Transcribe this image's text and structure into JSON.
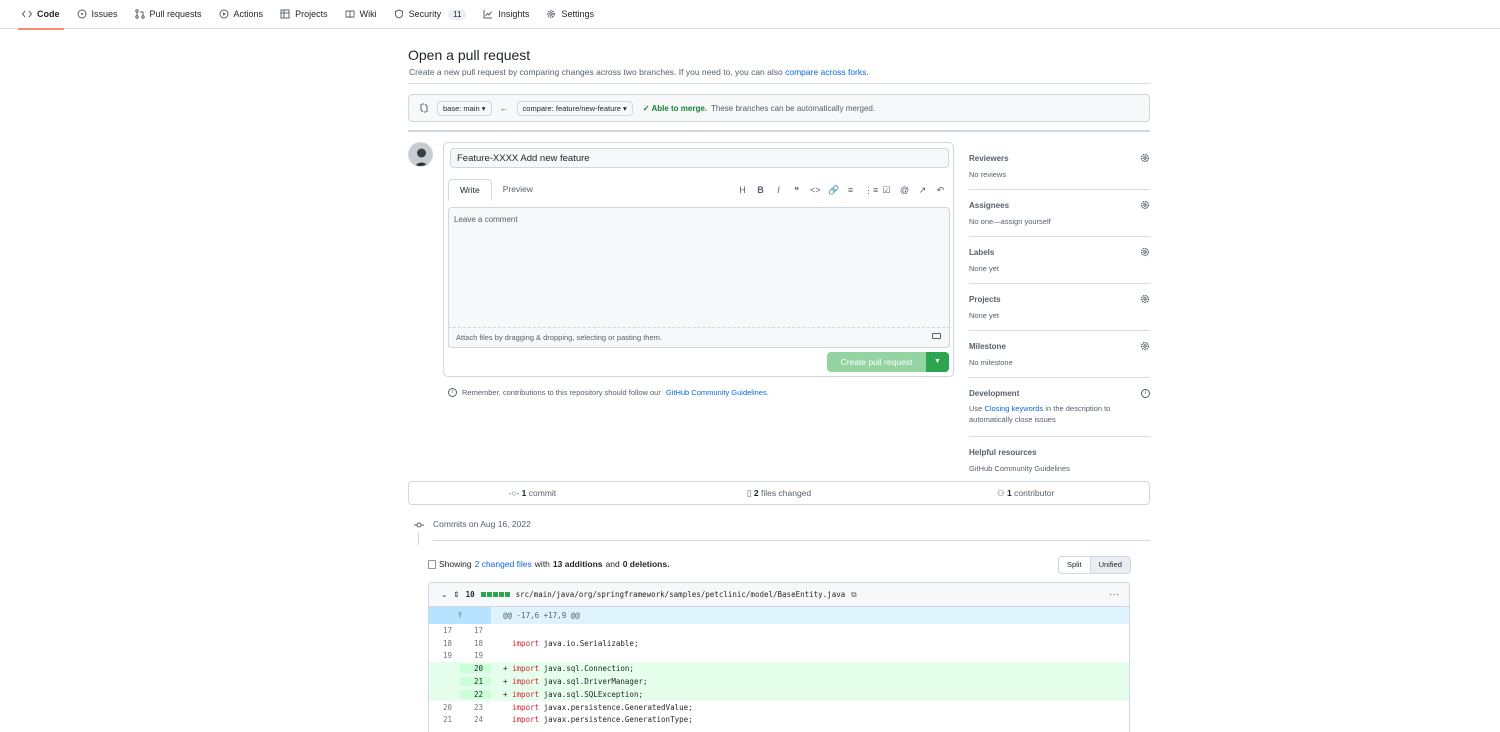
{
  "nav": {
    "tabs": [
      {
        "label": "Code",
        "icon": "code-icon"
      },
      {
        "label": "Issues",
        "icon": "issue-icon"
      },
      {
        "label": "Pull requests",
        "icon": "pull-request-icon"
      },
      {
        "label": "Actions",
        "icon": "play-icon"
      },
      {
        "label": "Projects",
        "icon": "table-icon"
      },
      {
        "label": "Wiki",
        "icon": "book-icon"
      },
      {
        "label": "Security",
        "icon": "shield-icon",
        "count": "11"
      },
      {
        "label": "Insights",
        "icon": "graph-icon"
      },
      {
        "label": "Settings",
        "icon": "gear-icon"
      }
    ],
    "active": "Code"
  },
  "header": {
    "title": "Open a pull request",
    "subtitle": "Create a new pull request by comparing changes across two branches. If you need to, you can also",
    "subtitle_link": "compare across forks."
  },
  "compare": {
    "base": "base: main ▾",
    "compare": "compare: feature/new-feature ▾",
    "merge_status": "Able to merge.",
    "merge_note": "These branches can be automatically merged."
  },
  "composer": {
    "title_value": "Feature-XXXX Add new feature",
    "tab_write": "Write",
    "tab_preview": "Preview",
    "toolbar": [
      "H",
      "B",
      "I",
      "❝",
      "<>",
      "🔗",
      "≡",
      "⋮≡",
      "☑",
      "@",
      "↗",
      "↶"
    ],
    "comment_placeholder": "Leave a comment",
    "attach_hint": "Attach files by dragging & dropping, selecting or pasting them.",
    "create_button": "Create pull request",
    "remember_text": "Remember, contributions to this repository should follow our",
    "remember_link": "GitHub Community Guidelines."
  },
  "sidebar": {
    "reviewers": {
      "heading": "Reviewers",
      "value": "No reviews"
    },
    "assignees": {
      "heading": "Assignees",
      "value": "No one—assign yourself"
    },
    "labels": {
      "heading": "Labels",
      "value": "None yet"
    },
    "projects": {
      "heading": "Projects",
      "value": "None yet"
    },
    "milestone": {
      "heading": "Milestone",
      "value": "No milestone"
    },
    "development": {
      "heading": "Development",
      "pre": "Use",
      "link": "Closing keywords",
      "post": "in the description to automatically close issues"
    },
    "helpful": {
      "heading": "Helpful resources",
      "link": "GitHub Community Guidelines"
    }
  },
  "summary": {
    "commits_count": "1",
    "commits_label": "commit",
    "files_count": "2",
    "files_label": "files changed",
    "contributors_count": "1",
    "contributors_label": "contributor"
  },
  "commits": {
    "heading": "Commits on Aug 16, 2022"
  },
  "files": {
    "showing_prefix": "Showing",
    "changed_link": "2 changed files",
    "with": "with",
    "additions": "13 additions",
    "and": "and",
    "deletions": "0 deletions.",
    "split": "Split",
    "unified": "Unified"
  },
  "diff": {
    "count": "10",
    "path": "src/main/java/org/springframework/samples/petclinic/model/BaseEntity.java",
    "hunk": "@@ -17,6 +17,9 @@",
    "lines": [
      {
        "old": "17",
        "new": "17",
        "sign": " ",
        "kw": "",
        "text": ""
      },
      {
        "old": "18",
        "new": "18",
        "sign": " ",
        "kw": "import",
        "text": " java.io.Serializable;"
      },
      {
        "old": "19",
        "new": "19",
        "sign": " ",
        "kw": "",
        "text": ""
      },
      {
        "old": "",
        "new": "20",
        "sign": "+",
        "kw": "import",
        "text": " java.sql.Connection;"
      },
      {
        "old": "",
        "new": "21",
        "sign": "+",
        "kw": "import",
        "text": " java.sql.DriverManager;"
      },
      {
        "old": "",
        "new": "22",
        "sign": "+",
        "kw": "import",
        "text": " java.sql.SQLException;"
      },
      {
        "old": "20",
        "new": "23",
        "sign": " ",
        "kw": "import",
        "text": " javax.persistence.GeneratedValue;"
      },
      {
        "old": "21",
        "new": "24",
        "sign": " ",
        "kw": "import",
        "text": " javax.persistence.GenerationType;"
      }
    ]
  }
}
